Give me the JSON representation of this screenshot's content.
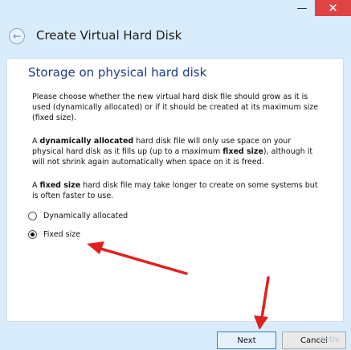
{
  "window": {
    "minimize_glyph": "—",
    "close_glyph": "✕"
  },
  "wizard": {
    "title": "Create Virtual Hard Disk",
    "back_glyph": "←"
  },
  "page": {
    "title": "Storage on physical hard disk",
    "intro": "Please choose whether the new virtual hard disk file should grow as it is used (dynamically allocated) or if it should be created at its maximum size (fixed size).",
    "dynamic_p": {
      "pre": "A ",
      "bold1": "dynamically allocated",
      "mid": " hard disk file will only use space on your physical hard disk as it fills up (up to a maximum ",
      "bold2": "fixed size",
      "post": "), although it will not shrink again automatically when space on it is freed."
    },
    "fixed_p": {
      "pre": "A ",
      "bold": "fixed size",
      "post": " hard disk file may take longer to create on some systems but is often faster to use."
    },
    "options": [
      {
        "label": "Dynamically allocated",
        "checked": false
      },
      {
        "label": "Fixed size",
        "checked": true
      }
    ]
  },
  "buttons": {
    "next": "Next",
    "cancel": "Cancel"
  },
  "watermark": "Activ",
  "annotation_color": "#e02020"
}
